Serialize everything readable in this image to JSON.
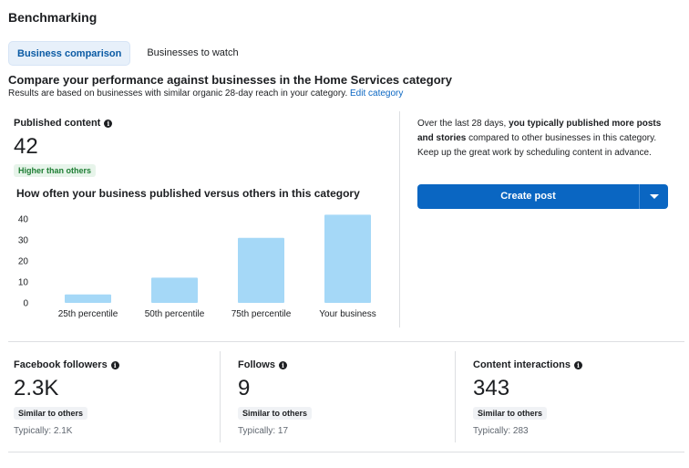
{
  "page": {
    "heading": "Benchmarking"
  },
  "tabs": [
    {
      "label": "Business comparison",
      "active": true
    },
    {
      "label": "Businesses to watch",
      "active": false
    }
  ],
  "section": {
    "title": "Compare your performance against businesses in the Home Services category",
    "subtitle": "Results are based on businesses with similar organic 28-day reach in your category.",
    "edit_link": "Edit category"
  },
  "published": {
    "label": "Published content",
    "value": "42",
    "badge": "Higher than others",
    "chart_title": "How often your business published versus others in this category"
  },
  "chart_data": {
    "type": "bar",
    "categories": [
      "25th percentile",
      "50th percentile",
      "75th percentile",
      "Your business"
    ],
    "values": [
      4,
      12,
      31,
      42
    ],
    "ylim": [
      0,
      40
    ],
    "yticks": [
      "0",
      "10",
      "20",
      "30",
      "40"
    ],
    "bar_color": "#a5d8f7",
    "grid": false
  },
  "insight": {
    "text_before": "Over the last 28 days, ",
    "text_bold": "you typically published more posts and stories",
    "text_after": " compared to other businesses in this category. Keep up the great work by scheduling content in advance."
  },
  "create_button": {
    "label": "Create post",
    "dropdown_icon": "caret-down-icon"
  },
  "stats": [
    {
      "label": "Facebook followers",
      "value": "2.3K",
      "badge": "Similar to others",
      "typical": "Typically: 2.1K"
    },
    {
      "label": "Follows",
      "value": "9",
      "badge": "Similar to others",
      "typical": "Typically: 17"
    },
    {
      "label": "Content interactions",
      "value": "343",
      "badge": "Similar to others",
      "typical": "Typically: 283"
    }
  ],
  "colors": {
    "accent": "#0a66c2",
    "tab_active_bg": "#e7f0fa",
    "positive_bg": "#e7f4ea",
    "positive_text": "#1e7e34"
  }
}
